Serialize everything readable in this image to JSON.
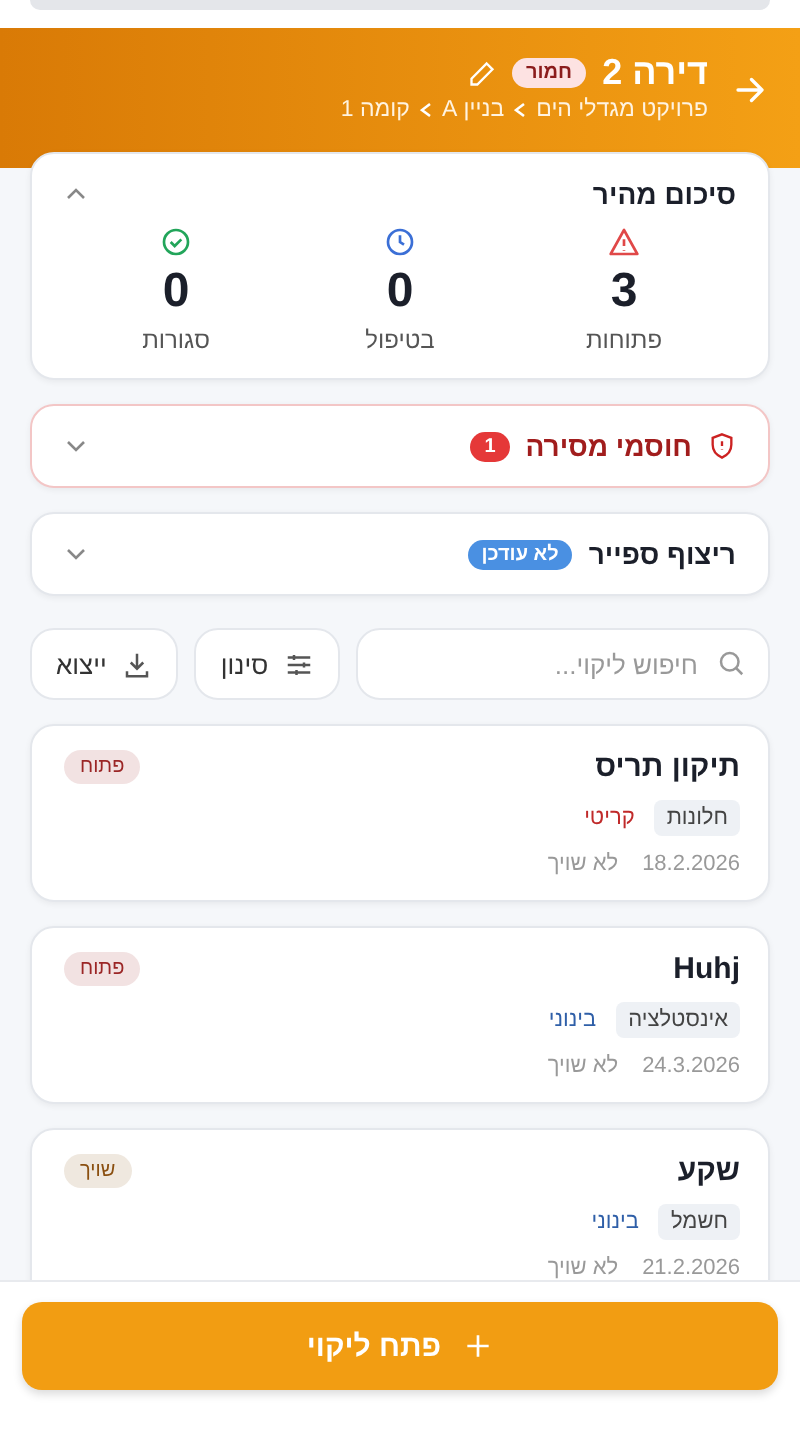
{
  "header": {
    "title": "דירה 2",
    "severity_badge": "חמור",
    "breadcrumb": [
      "פרויקט מגדלי הים",
      "בניין A",
      "קומה 1"
    ]
  },
  "summary": {
    "title": "סיכום מהיר",
    "expanded": true,
    "stats": [
      {
        "kind": "open",
        "value": "3",
        "label": "פתוחות"
      },
      {
        "kind": "progress",
        "value": "0",
        "label": "בטיפול"
      },
      {
        "kind": "closed",
        "value": "0",
        "label": "סגורות"
      }
    ]
  },
  "blockers": {
    "title": "חוסמי מסירה",
    "count": "1",
    "expanded": false
  },
  "spare": {
    "title": "ריצוף ספייר",
    "badge": "לא עודכן",
    "expanded": false
  },
  "toolbar": {
    "search": {
      "placeholder": "חיפוש ליקוי..."
    },
    "filter": "סינון",
    "export": "ייצוא"
  },
  "issues": [
    {
      "title": "תיקון תריס",
      "category": "חלונות",
      "severity": {
        "text": "קריטי",
        "color": "#c02a2a"
      },
      "date": "18.2.2026",
      "assignee": "לא שויך",
      "status": {
        "text": "פתוח",
        "color": "#9b2626"
      }
    },
    {
      "title": "Huhj",
      "category": "אינסטלציה",
      "severity": {
        "text": "בינוני",
        "color": "#2f5fa8"
      },
      "date": "24.3.2026",
      "assignee": "לא שויך",
      "status": {
        "text": "פתוח",
        "color": "#9b2626"
      }
    },
    {
      "title": "שקע",
      "category": "חשמל",
      "severity": {
        "text": "בינוני",
        "color": "#2f5fa8"
      },
      "date": "21.2.2026",
      "assignee": "לא שויך",
      "status": {
        "text": "שויך",
        "color": "#8a4f10"
      }
    }
  ],
  "action": {
    "label": "פתח ליקוי"
  }
}
